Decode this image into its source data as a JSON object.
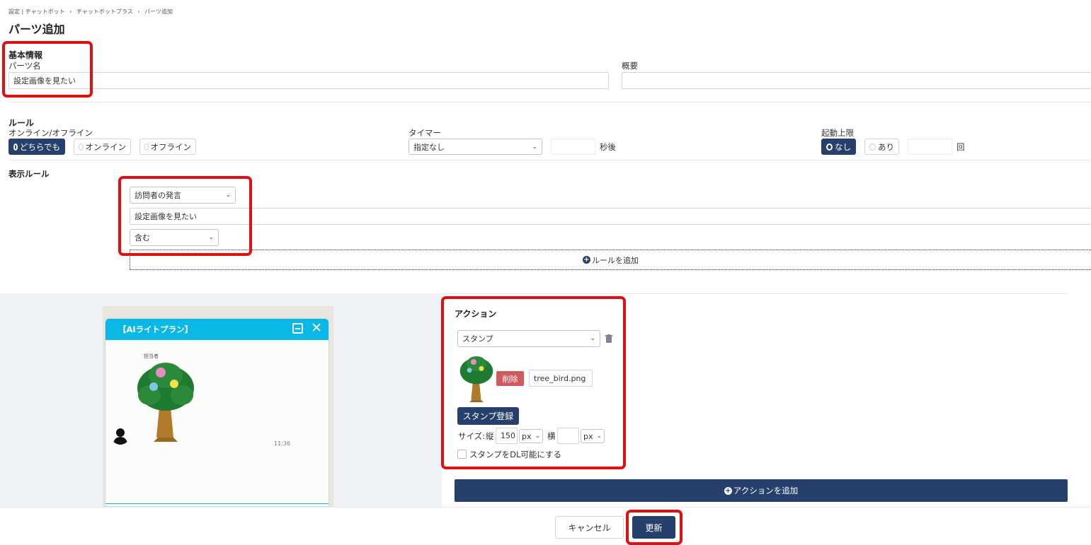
{
  "breadcrumb": [
    "設定 | チャットボット",
    "›",
    "チャットボットプラス",
    "›",
    "パーツ追加"
  ],
  "page_title": "パーツ追加",
  "basic_info": {
    "title": "基本情報",
    "part_name_label": "パーツ名",
    "part_name_value": "設定画像を見たい",
    "summary_label": "概要",
    "summary_value": ""
  },
  "rule": {
    "title": "ルール",
    "online_label": "オンライン/オフライン",
    "online_options": [
      "どちらでも",
      "オンライン",
      "オフライン"
    ],
    "online_selected": "どちらでも",
    "timer_label": "タイマー",
    "timer_select": "指定なし",
    "timer_value": "",
    "timer_suffix": "秒後",
    "limit_label": "起動上限",
    "limit_options": [
      "なし",
      "あり"
    ],
    "limit_selected": "なし",
    "limit_value": "",
    "limit_suffix": "回"
  },
  "display_rule": {
    "title": "表示ルール",
    "condition_select": "訪問者の発言",
    "keyword_value": "設定画像を見たい",
    "match_select": "含む",
    "add_rule_label": "ルールを追加"
  },
  "preview": {
    "chat_title": "【AIライトプラン】",
    "agent_label": "担当者",
    "time": "11:36"
  },
  "action": {
    "title": "アクション",
    "type_select": "スタンプ",
    "delete_label": "削除",
    "file_name": "tree_bird.png",
    "register_label": "スタンプ登録",
    "size_label": "サイズ:",
    "height_label": "縦",
    "height_value": "150",
    "height_unit": "px",
    "width_label": "横",
    "width_value": "",
    "width_unit": "px",
    "dl_label": "スタンプをDL可能にする",
    "add_action_label": "アクションを追加"
  },
  "footer": {
    "cancel_label": "キャンセル",
    "update_label": "更新"
  },
  "colors": {
    "primary": "#27406b",
    "highlight": "#e01010",
    "chat_header": "#0ab8e6",
    "delete": "#d05a5f"
  }
}
